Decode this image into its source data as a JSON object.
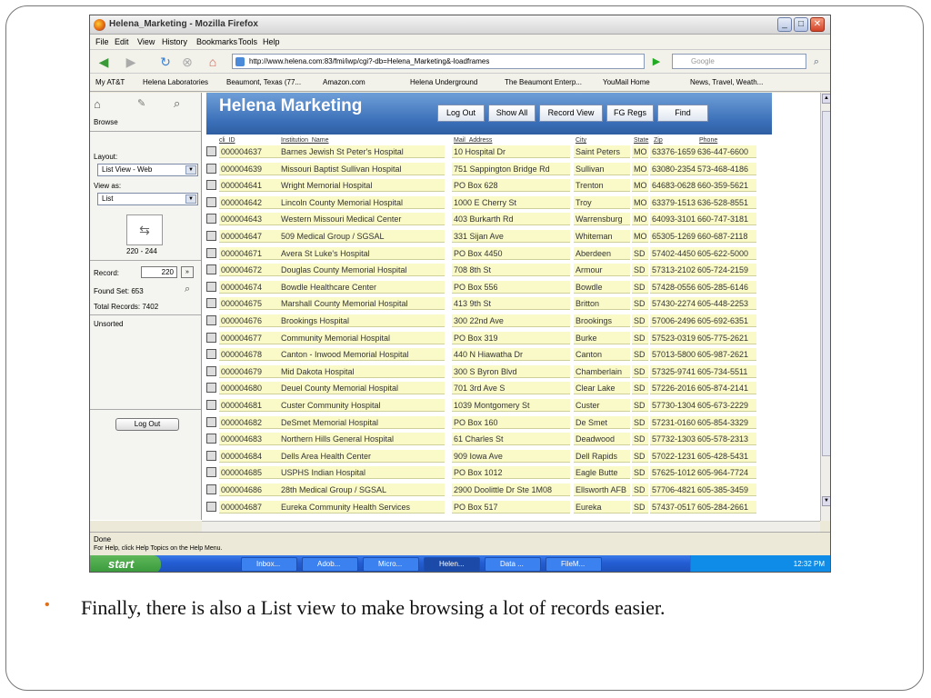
{
  "window": {
    "title": "Helena_Marketing - Mozilla Firefox",
    "min": "_",
    "max": "□",
    "close": "✕"
  },
  "menu": [
    "File",
    "Edit",
    "View",
    "History",
    "Bookmarks",
    "Tools",
    "Help"
  ],
  "nav": {
    "url": "http://www.helena.com:83/fmi/iwp/cgi?-db=Helena_Marketing&-loadframes",
    "search_placeholder": "Google"
  },
  "bookmarks": [
    "My AT&T",
    "Helena Laboratories",
    "Beaumont, Texas (77...",
    "Amazon.com",
    "Helena Underground",
    "The Beaumont Enterp...",
    "YouMail Home",
    "News, Travel, Weath..."
  ],
  "sidebar": {
    "browse": "Browse",
    "layout_label": "Layout:",
    "layout_value": "List View - Web",
    "view_label": "View as:",
    "view_value": "List",
    "range": "220 - 244",
    "record_label": "Record:",
    "record_value": "220",
    "found": "Found Set: 653",
    "total": "Total Records: 7402",
    "sort": "Unsorted",
    "logout": "Log Out"
  },
  "app": {
    "brand": "Helena Marketing",
    "buttons": [
      "Log Out",
      "Show All",
      "Record View",
      "FG Regs",
      "Find"
    ]
  },
  "columns": [
    "cli_ID",
    "Institution_Name",
    "Mail_Address",
    "City",
    "State",
    "Zip",
    "Phone"
  ],
  "rows": [
    [
      "000004637",
      "Barnes Jewish St Peter's Hospital",
      "10 Hospital Dr",
      "Saint Peters",
      "MO",
      "63376-1659",
      "636-447-6600"
    ],
    [
      "000004639",
      "Missouri Baptist Sullivan Hospital",
      "751 Sappington Bridge Rd",
      "Sullivan",
      "MO",
      "63080-2354",
      "573-468-4186"
    ],
    [
      "000004641",
      "Wright Memorial Hospital",
      "PO Box 628",
      "Trenton",
      "MO",
      "64683-0628",
      "660-359-5621"
    ],
    [
      "000004642",
      "Lincoln County Memorial Hospital",
      "1000 E Cherry St",
      "Troy",
      "MO",
      "63379-1513",
      "636-528-8551"
    ],
    [
      "000004643",
      "Western Missouri Medical Center",
      "403 Burkarth Rd",
      "Warrensburg",
      "MO",
      "64093-3101",
      "660-747-3181"
    ],
    [
      "000004647",
      "509 Medical Group / SGSAL",
      "331 Sijan Ave",
      "Whiteman",
      "MO",
      "65305-1269",
      "660-687-2118"
    ],
    [
      "000004671",
      "Avera St Luke's Hospital",
      "PO Box 4450",
      "Aberdeen",
      "SD",
      "57402-4450",
      "605-622-5000"
    ],
    [
      "000004672",
      "Douglas County Memorial Hospital",
      "708 8th St",
      "Armour",
      "SD",
      "57313-2102",
      "605-724-2159"
    ],
    [
      "000004674",
      "Bowdle Healthcare Center",
      "PO Box 556",
      "Bowdle",
      "SD",
      "57428-0556",
      "605-285-6146"
    ],
    [
      "000004675",
      "Marshall County Memorial Hospital",
      "413 9th St",
      "Britton",
      "SD",
      "57430-2274",
      "605-448-2253"
    ],
    [
      "000004676",
      "Brookings Hospital",
      "300 22nd Ave",
      "Brookings",
      "SD",
      "57006-2496",
      "605-692-6351"
    ],
    [
      "000004677",
      "Community Memorial Hospital",
      "PO Box 319",
      "Burke",
      "SD",
      "57523-0319",
      "605-775-2621"
    ],
    [
      "000004678",
      "Canton - Inwood Memorial Hospital",
      "440 N Hiawatha Dr",
      "Canton",
      "SD",
      "57013-5800",
      "605-987-2621"
    ],
    [
      "000004679",
      "Mid Dakota Hospital",
      "300 S Byron Blvd",
      "Chamberlain",
      "SD",
      "57325-9741",
      "605-734-5511"
    ],
    [
      "000004680",
      "Deuel County Memorial Hospital",
      "701 3rd Ave S",
      "Clear Lake",
      "SD",
      "57226-2016",
      "605-874-2141"
    ],
    [
      "000004681",
      "Custer Community Hospital",
      "1039 Montgomery St",
      "Custer",
      "SD",
      "57730-1304",
      "605-673-2229"
    ],
    [
      "000004682",
      "DeSmet Memorial Hospital",
      "PO Box 160",
      "De Smet",
      "SD",
      "57231-0160",
      "605-854-3329"
    ],
    [
      "000004683",
      "Northern Hills General Hospital",
      "61 Charles St",
      "Deadwood",
      "SD",
      "57732-1303",
      "605-578-2313"
    ],
    [
      "000004684",
      "Dells Area Health Center",
      "909 Iowa Ave",
      "Dell Rapids",
      "SD",
      "57022-1231",
      "605-428-5431"
    ],
    [
      "000004685",
      "USPHS Indian Hospital",
      "PO Box 1012",
      "Eagle Butte",
      "SD",
      "57625-1012",
      "605-964-7724"
    ],
    [
      "000004686",
      "28th Medical Group / SGSAL",
      "2900 Doolittle Dr Ste 1M08",
      "Ellsworth AFB",
      "SD",
      "57706-4821",
      "605-385-3459"
    ],
    [
      "000004687",
      "Eureka Community Health Services",
      "PO Box 517",
      "Eureka",
      "SD",
      "57437-0517",
      "605-284-2661"
    ]
  ],
  "status": "Done",
  "help": "For Help, click Help Topics on the Help Menu.",
  "taskbar": {
    "start": "start",
    "items": [
      "Inbox...",
      "Adob...",
      "Micro...",
      "Helen...",
      "Data ...",
      "FileM..."
    ],
    "time": "12:32 PM"
  },
  "caption": "Finally, there is also a List view to make browsing a lot of records easier.",
  "bullet": "•"
}
